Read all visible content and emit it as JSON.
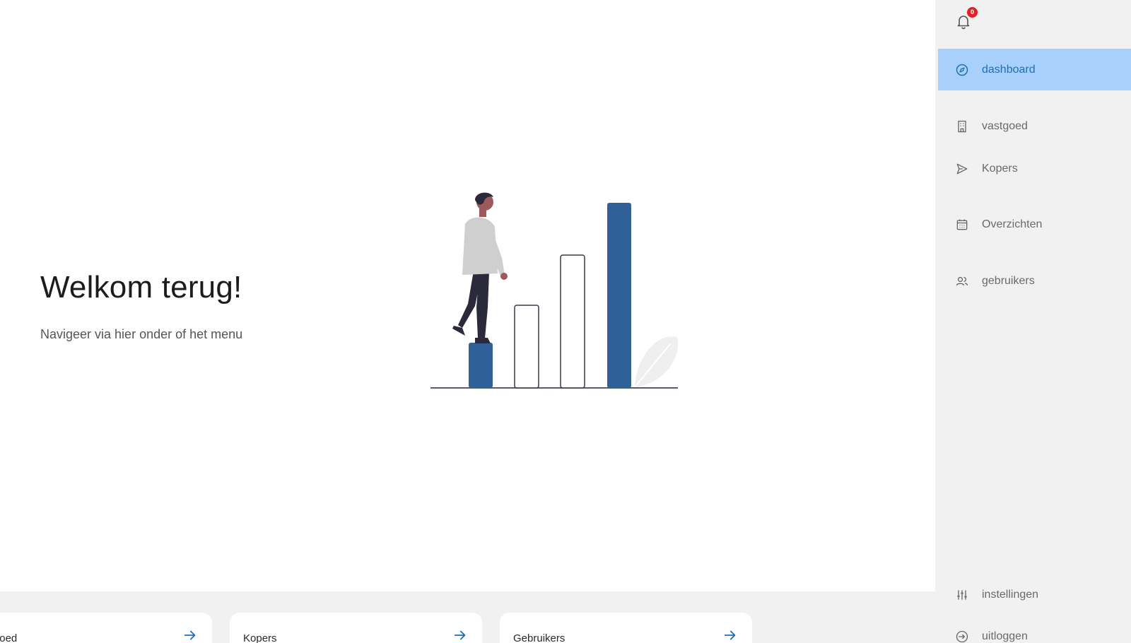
{
  "main": {
    "title": "Welkom terug!",
    "subtitle": "Navigeer via hier onder of het menu"
  },
  "cards": [
    {
      "label": "Vastgoed"
    },
    {
      "label": "Kopers"
    },
    {
      "label": "Gebruikers"
    }
  ],
  "notifications": {
    "count": "0",
    "icon": "bell-icon"
  },
  "sidebar": {
    "items": [
      {
        "label": "dashboard",
        "icon": "compass-icon",
        "active": true
      },
      {
        "label": "vastgoed",
        "icon": "building-icon"
      },
      {
        "label": "Kopers",
        "icon": "send-icon"
      },
      {
        "label": "Overzichten",
        "icon": "calendar-icon"
      },
      {
        "label": "gebruikers",
        "icon": "users-icon"
      }
    ],
    "bottom": [
      {
        "label": "instellingen",
        "icon": "sliders-icon"
      },
      {
        "label": "uitloggen",
        "icon": "logout-icon"
      }
    ]
  },
  "colors": {
    "accent": "#2f6098",
    "active_bg": "#a9cffb",
    "active_text": "#1f6fb3",
    "badge": "#e81e25",
    "arrow": "#1f6fb3"
  }
}
